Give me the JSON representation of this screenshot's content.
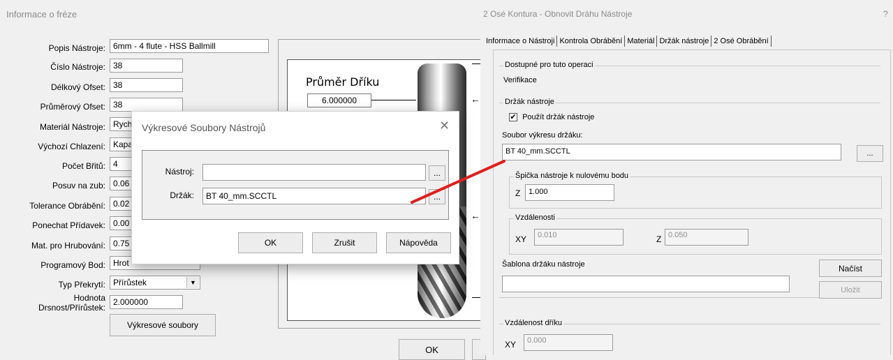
{
  "left_window": {
    "title": "Informace o fréze",
    "fields": [
      {
        "label": "Popis Nástroje:",
        "value": "6mm - 4 flute - HSS Ballmill"
      },
      {
        "label": "Číslo Nástroje:",
        "value": "38"
      },
      {
        "label": "Délkový Ofset:",
        "value": "38"
      },
      {
        "label": "Průměrový Ofset:",
        "value": "38"
      },
      {
        "label": "Materiál Nástroje:",
        "value": "Rych"
      },
      {
        "label": "Výchozí Chlazení:",
        "value": "Kapa"
      },
      {
        "label": "Počet Břitů:",
        "value": "4"
      },
      {
        "label": "Posuv na zub:",
        "value": "0.06"
      },
      {
        "label": "Tolerance Obrábění:",
        "value": "0.02"
      },
      {
        "label": "Ponechat Přídavek:",
        "value": "0.00"
      },
      {
        "label": "Mat. pro Hrubování:",
        "value": "0.75"
      },
      {
        "label": "Programový Bod:",
        "value": "Hrot"
      },
      {
        "label": "Typ Překrytí:",
        "value": "Přírůstek"
      }
    ],
    "hodnota_label_1": "Hodnota",
    "hodnota_label_2": "Drsnost/Přírůstek:",
    "hodnota_value": "2.000000",
    "drawings_button": "Výkresové soubory",
    "preview": {
      "diameter_label": "Průměr Dříku",
      "diameter_value": "6.000000"
    },
    "ok_button": "OK"
  },
  "dialog": {
    "title": "Výkresové Soubory Nástrojů",
    "tool_label": "Nástroj:",
    "tool_value": "",
    "holder_label": "Držák:",
    "holder_value": "BT 40_mm.SCCTL",
    "browse": "...",
    "ok": "OK",
    "cancel": "Zrušit",
    "help": "Nápověda"
  },
  "right_window": {
    "title": "2 Osé Kontura - Obnovit Dráhu Nástroje",
    "help": "?",
    "tabs": [
      "Informace o Nástroji",
      "Kontrola Obrábění",
      "Materiál",
      "Držák nástroje",
      "2 Osé Obrábění"
    ],
    "available_group": "Dostupné pro tuto operaci",
    "available_value": "Verifikace",
    "holder_group": "Držák nástroje",
    "use_holder": "Použít držák nástroje",
    "holder_file_label": "Soubor výkresu držáku:",
    "holder_file_value": "BT 40_mm.SCCTL",
    "browse": "...",
    "tip_group": "Špička nástroje k nulovému bodu",
    "tip_z_label": "Z",
    "tip_z_value": "1.000",
    "dist_group": "Vzdálenosti",
    "dist_xy_label": "XY",
    "dist_xy_value": "0.010",
    "dist_z_label": "Z",
    "dist_z_value": "0.050",
    "template_label": "Šablona držáku nástroje",
    "template_value": "",
    "load_button": "Načíst",
    "save_button": "Uložit",
    "shank_group": "Vzdálenost dříku",
    "shank_xy_label": "XY",
    "shank_xy_value": "0.000"
  },
  "colors": {
    "annotation_line": "#e01e1e",
    "dialog_bg": "#ffffff",
    "window_bg": "#f0f0f0"
  }
}
